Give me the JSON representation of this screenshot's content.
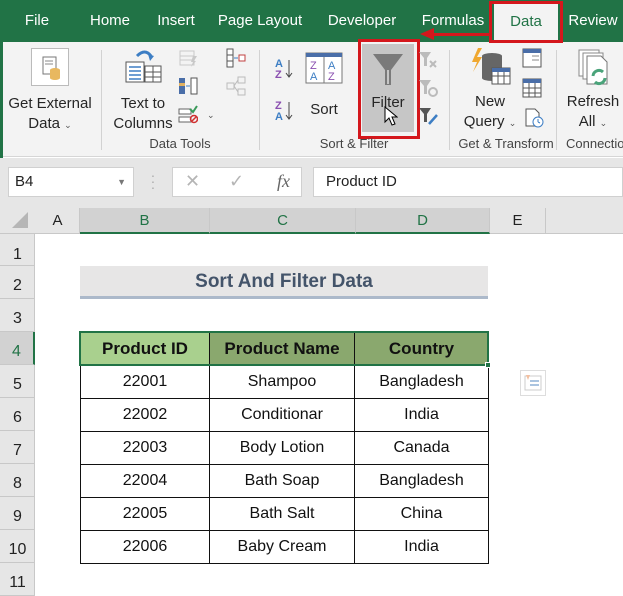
{
  "tabs": [
    {
      "label": "File",
      "active": false
    },
    {
      "label": "Home",
      "active": false
    },
    {
      "label": "Insert",
      "active": false
    },
    {
      "label": "Page Layout",
      "active": false
    },
    {
      "label": "Developer",
      "active": false
    },
    {
      "label": "Formulas",
      "active": false
    },
    {
      "label": "Data",
      "active": true
    },
    {
      "label": "Review",
      "active": false
    }
  ],
  "ribbon": {
    "get_external_data": {
      "line1": "Get External",
      "line2": "Data",
      "icon": "database-file-icon"
    },
    "text_to_columns": {
      "line1": "Text to",
      "line2": "Columns",
      "icon": "text-to-columns-icon"
    },
    "data_tools_label": "Data Tools",
    "sort_az_icon": "sort-a-to-z-icon",
    "sort_za_icon": "sort-z-to-a-icon",
    "sort": {
      "label": "Sort",
      "icon": "sort-dialog-icon"
    },
    "filter": {
      "label": "Filter",
      "icon": "funnel-icon",
      "highlighted": true
    },
    "clear_icon": "clear-filter-icon",
    "reapply_icon": "reapply-filter-icon",
    "advanced_icon": "advanced-filter-icon",
    "sort_filter_label": "Sort & Filter",
    "new_query": {
      "line1": "New",
      "line2": "Query",
      "icon": "new-query-icon"
    },
    "get_transform_label": "Get & Transform",
    "refresh_all": {
      "line1": "Refresh",
      "line2": "All",
      "icon": "refresh-all-icon"
    },
    "connections_label": "Connectio"
  },
  "formula_bar": {
    "name_box": "B4",
    "formula": "Product ID",
    "fx_label": "fx",
    "cancel_glyph": "✕",
    "enter_glyph": "✓"
  },
  "columns": [
    "A",
    "B",
    "C",
    "D",
    "E"
  ],
  "rows": [
    "1",
    "2",
    "3",
    "4",
    "5",
    "6",
    "7",
    "8",
    "9",
    "10",
    "11"
  ],
  "sheet": {
    "title": "Sort And Filter Data",
    "headers": [
      "Product ID",
      "Product Name",
      "Country"
    ],
    "records": [
      [
        "22001",
        "Shampoo",
        "Bangladesh"
      ],
      [
        "22002",
        "Conditionar",
        "India"
      ],
      [
        "22003",
        "Body Lotion",
        "Canada"
      ],
      [
        "22004",
        "Bath Soap",
        "Bangladesh"
      ],
      [
        "22005",
        "Bath Salt",
        "China"
      ],
      [
        "22006",
        "Baby Cream",
        "India"
      ]
    ]
  },
  "colors": {
    "excel_green": "#217346",
    "highlight_red": "#d4171c",
    "header_light_green": "#a9d08e",
    "header_dark_green": "#8aa86e",
    "title_text": "#44546a"
  }
}
